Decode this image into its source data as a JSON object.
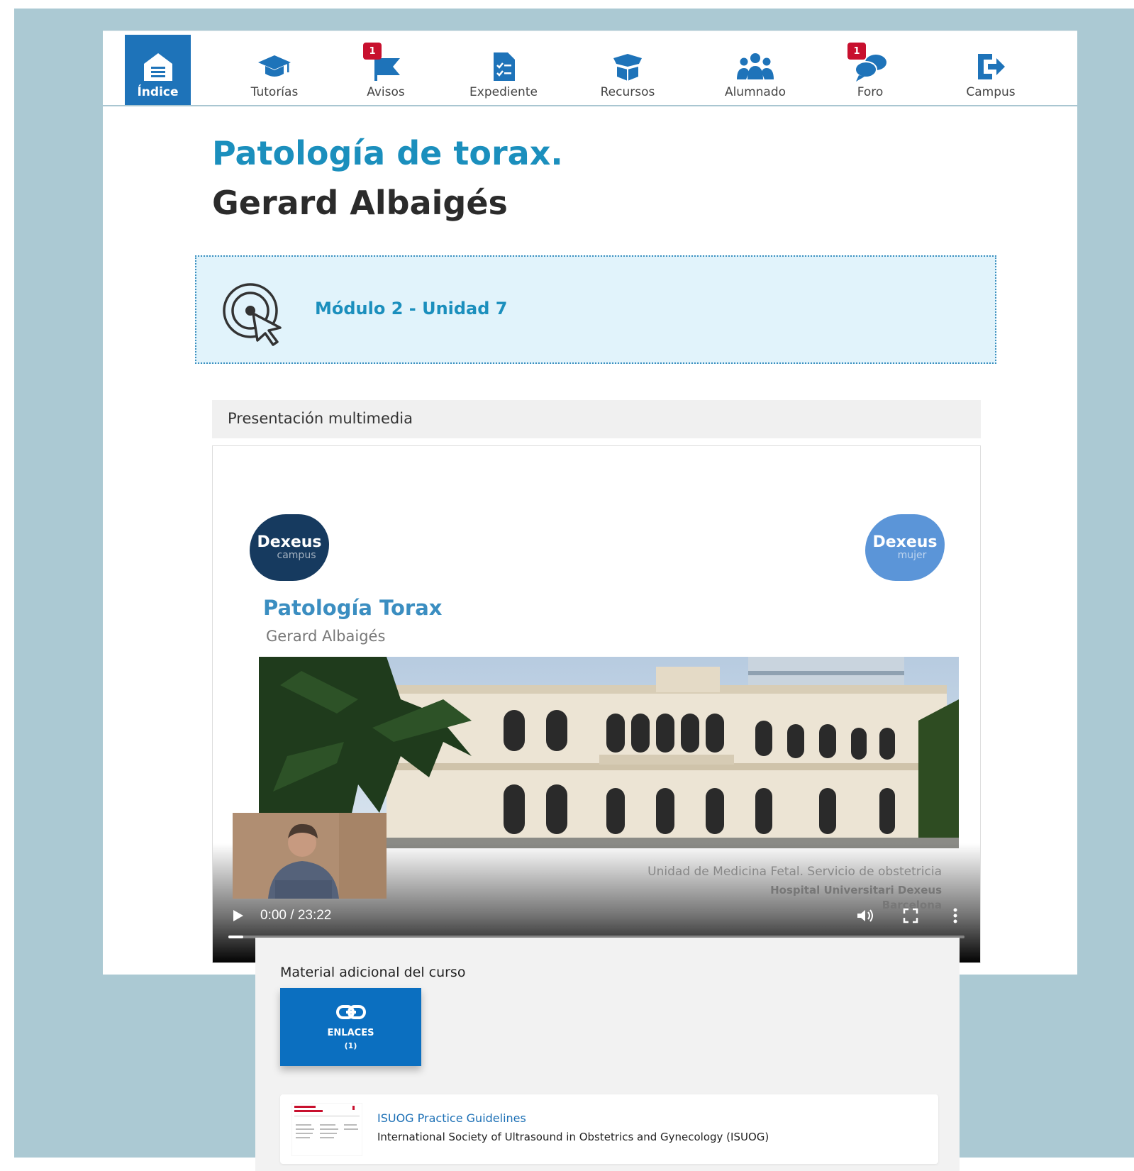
{
  "nav": {
    "items": [
      {
        "label": "Índice",
        "icon": "home-icon",
        "active": true
      },
      {
        "label": "Tutorías",
        "icon": "graduation-cap-icon"
      },
      {
        "label": "Avisos",
        "icon": "flag-icon",
        "badge": "1"
      },
      {
        "label": "Expediente",
        "icon": "checklist-document-icon"
      },
      {
        "label": "Recursos",
        "icon": "box-icon"
      },
      {
        "label": "Alumnado",
        "icon": "users-icon"
      },
      {
        "label": "Foro",
        "icon": "comments-icon",
        "badge": "1"
      },
      {
        "label": "Campus",
        "icon": "sign-out-icon"
      }
    ]
  },
  "course": {
    "title": "Patología de torax.",
    "author": "Gerard Albaigés"
  },
  "module": {
    "label": "Módulo 2 - Unidad 7",
    "icon": "target-cursor-icon"
  },
  "presentation": {
    "heading": "Presentación multimedia",
    "slide": {
      "logo_left_main": "Dexeus",
      "logo_left_sub": "campus",
      "logo_right_main": "Dexeus",
      "logo_right_sub": "mujer",
      "title": "Patología Torax",
      "author": "Gerard Albaigés",
      "caption_line1": "Unidad de Medicina Fetal. Servicio de  obstetricia",
      "caption_line2": "Hospital Universitari Dexeus",
      "caption_line3": "Barcelona"
    },
    "player": {
      "time": "0:00 / 23:22",
      "progress": 0.02
    }
  },
  "material": {
    "heading": "Material adicional del curso",
    "button_label": "ENLACES",
    "button_count": "(1)",
    "resource": {
      "title": "ISUOG Practice Guidelines",
      "description": "International Society of Ultrasound in Obstetrics and Gynecology (ISUOG)"
    }
  },
  "colors": {
    "brand_blue": "#1e73b9",
    "title_blue": "#1b8fbd",
    "badge_red": "#c8102e",
    "backdrop": "#abc9d3"
  }
}
